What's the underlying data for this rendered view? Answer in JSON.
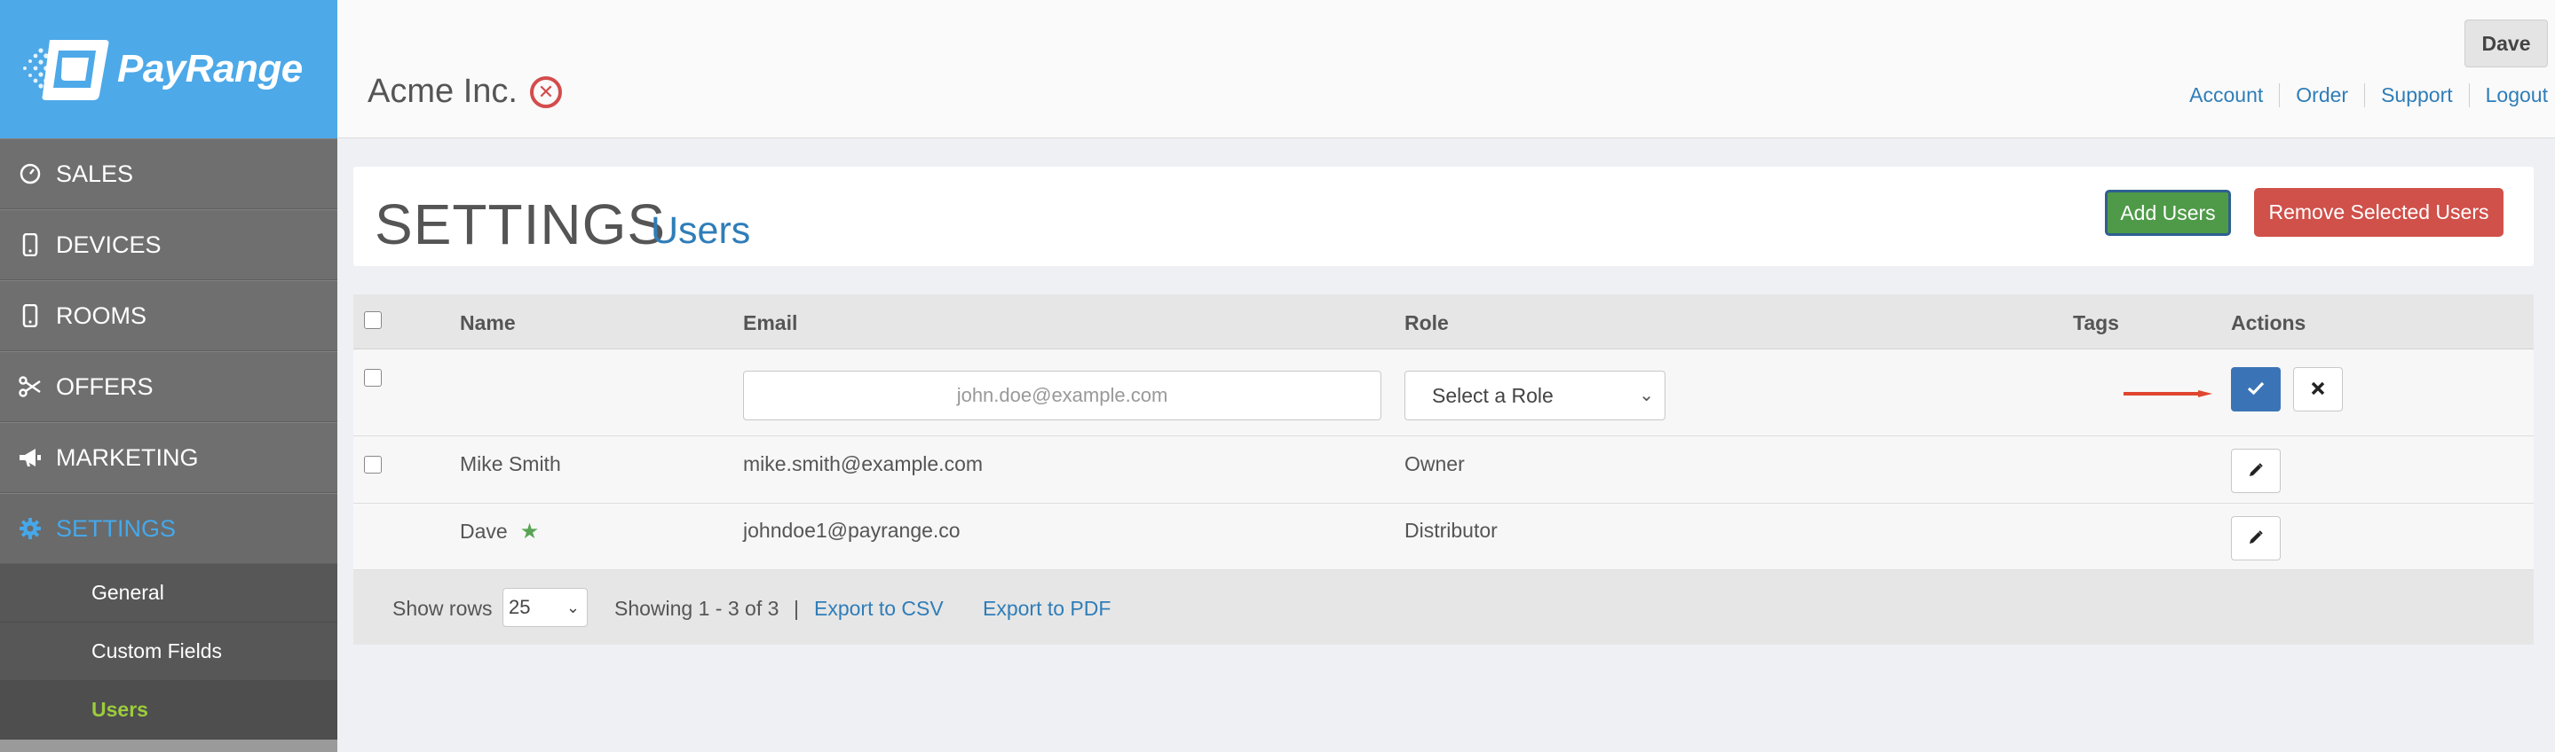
{
  "brand": {
    "name": "PayRange"
  },
  "sidebar": {
    "items": [
      {
        "label": "SALES",
        "icon": "speedometer-icon"
      },
      {
        "label": "DEVICES",
        "icon": "phone-icon"
      },
      {
        "label": "ROOMS",
        "icon": "phone-icon"
      },
      {
        "label": "OFFERS",
        "icon": "scissors-icon"
      },
      {
        "label": "MARKETING",
        "icon": "megaphone-icon"
      },
      {
        "label": "SETTINGS",
        "icon": "gear-icon",
        "active": true
      }
    ],
    "subitems": [
      {
        "label": "General"
      },
      {
        "label": "Custom Fields"
      },
      {
        "label": "Users",
        "active": true
      }
    ]
  },
  "header": {
    "company": "Acme Inc.",
    "user": "Dave",
    "links": [
      "Account",
      "Order",
      "Support",
      "Logout"
    ]
  },
  "page": {
    "title": "SETTINGS",
    "subtitle": "Users",
    "add_label": "Add Users",
    "remove_label": "Remove Selected Users"
  },
  "table": {
    "columns": {
      "name": "Name",
      "email": "Email",
      "role": "Role",
      "tags": "Tags",
      "actions": "Actions"
    },
    "new_row": {
      "email_placeholder": "john.doe@example.com",
      "role_placeholder": "Select a Role"
    },
    "rows": [
      {
        "name": "Mike Smith",
        "email": "mike.smith@example.com",
        "role": "Owner",
        "starred": false
      },
      {
        "name": "Dave",
        "email": "johndoe1@payrange.co",
        "role": "Distributor",
        "starred": true
      }
    ]
  },
  "footer": {
    "show_rows_label": "Show rows",
    "rows_value": "25",
    "showing": "Showing 1 - 3 of 3",
    "separator": "|",
    "export_csv": "Export to CSV",
    "export_pdf": "Export to PDF"
  },
  "colors": {
    "brand_blue": "#4da9e8",
    "active_nav": "#45a8ea",
    "active_sub": "#9ccc3c",
    "add_green": "#4f9a48",
    "remove_red": "#d0504a",
    "confirm_blue": "#3b74b6",
    "arrow_red": "#e0462f"
  }
}
